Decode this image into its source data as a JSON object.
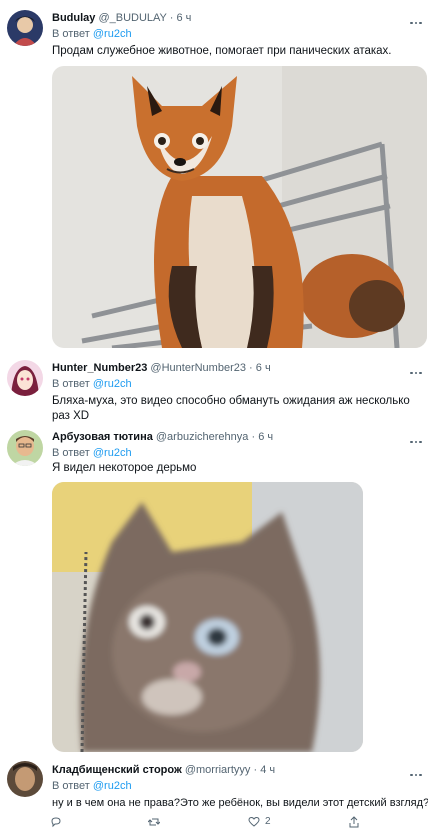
{
  "tweets": [
    {
      "name": "Budulay",
      "handle": "@_BUDULAY",
      "time": "6 ч",
      "reply_prefix": "В ответ",
      "reply_to": "@ru2ch",
      "text": "Продам служебное животное, помогает при панических атаках."
    },
    {
      "name": "Hunter_Number23",
      "handle": "@HunterNumber23",
      "time": "6 ч",
      "reply_prefix": "В ответ",
      "reply_to": "@ru2ch",
      "text": "Бляха-муха, это видео способно обмануть ожидания аж несколько раз XD"
    },
    {
      "name": "Арбузовая тютина",
      "handle": "@arbuzicherehnya",
      "time": "6 ч",
      "reply_prefix": "В ответ",
      "reply_to": "@ru2ch",
      "text": "Я видел некоторое дерьмо"
    },
    {
      "name": "Кладбищенский сторож",
      "handle": "@morriartyyy",
      "time": "4 ч",
      "reply_prefix": "В ответ",
      "reply_to": "@ru2ch",
      "text": "ну и в чем она не права?Это же ребёнок, вы видели этот детский взгляд?"
    }
  ],
  "actions": {
    "likes": "2"
  },
  "colors": {
    "accent": "#1d9bf0",
    "secondary": "#536471",
    "text": "#0f1419"
  },
  "icons": [
    "reply-icon",
    "retweet-icon",
    "like-icon",
    "share-icon",
    "more-icon"
  ]
}
